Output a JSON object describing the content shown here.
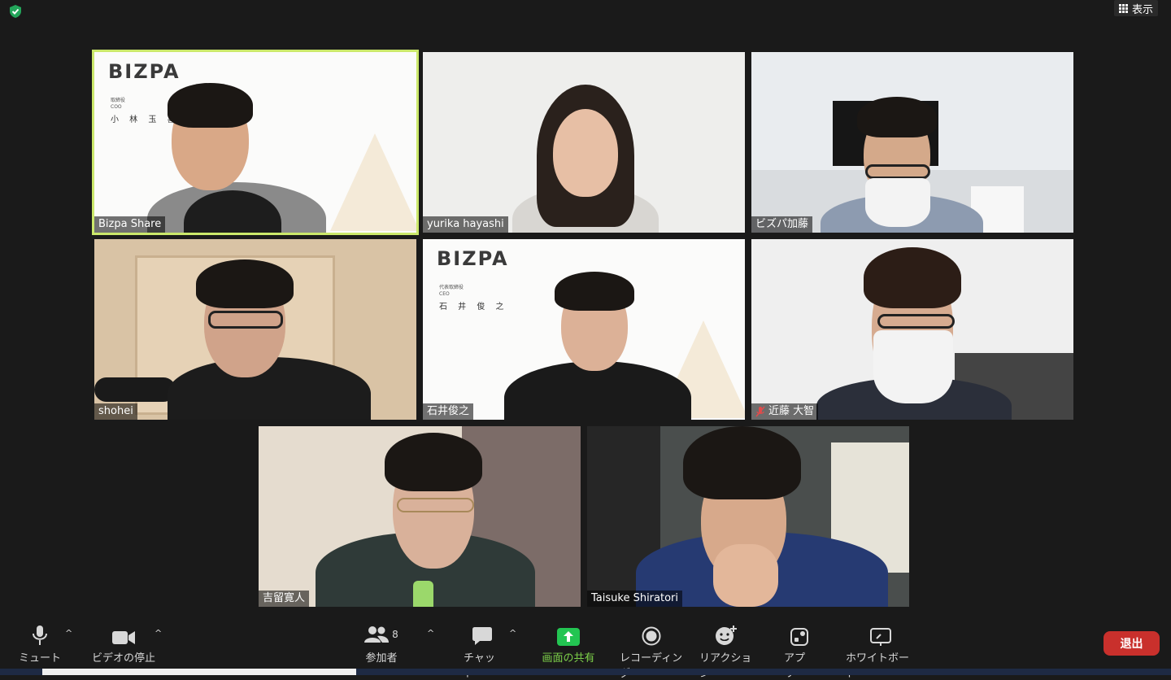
{
  "top": {
    "view_label": "表示"
  },
  "participants": [
    {
      "name": "Bizpa Share",
      "logo": "BIZPA",
      "logo_title": "取締役",
      "logo_role": "COO",
      "logo_person": "小 林 玉 喜"
    },
    {
      "name": "yurika hayashi"
    },
    {
      "name": "ビズパ加藤"
    },
    {
      "name": "shohei"
    },
    {
      "name": "石井俊之",
      "logo": "BIZPA",
      "logo_title": "代表取締役",
      "logo_role": "CEO",
      "logo_person": "石 井 俊 之"
    },
    {
      "name": "近藤 大智",
      "muted": true
    },
    {
      "name": "吉留寛人"
    },
    {
      "name": "Taisuke Shiratori"
    }
  ],
  "toolbar": {
    "mute_label": "ミュート",
    "video_label": "ビデオの停止",
    "participants_label": "参加者",
    "participants_count": "8",
    "chat_label": "チャット",
    "share_label": "画面の共有",
    "record_label": "レコーディング",
    "reaction_label": "リアクション",
    "apps_label": "アプリ",
    "whiteboard_label": "ホワイトボード",
    "leave_label": "退出"
  },
  "colors": {
    "active_speaker": "#cbe86b",
    "share_green": "#23c552",
    "leave_red": "#c9302c"
  }
}
